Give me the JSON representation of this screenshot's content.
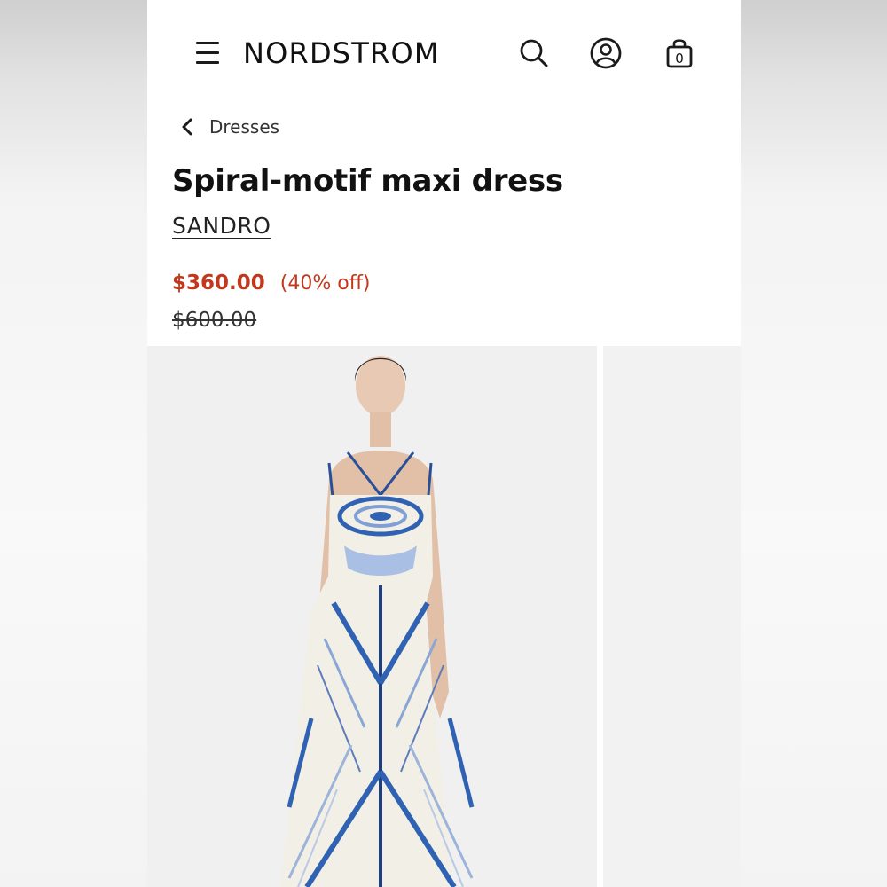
{
  "header": {
    "logo_text": "NORDSTROM",
    "icons": [
      "menu-icon",
      "search-icon",
      "account-icon",
      "shopping-bag-icon"
    ],
    "bag_count": "0"
  },
  "breadcrumb": {
    "back_label": "Dresses"
  },
  "product": {
    "title": "Spiral-motif maxi dress",
    "brand": "SANDRO",
    "sale_price": "$360.00",
    "discount": "(40% off)",
    "original_price": "$600.00"
  },
  "colors": {
    "sale_red": "#c2381c",
    "text_dark": "#111111",
    "dress_blue": "#2f62b3"
  }
}
